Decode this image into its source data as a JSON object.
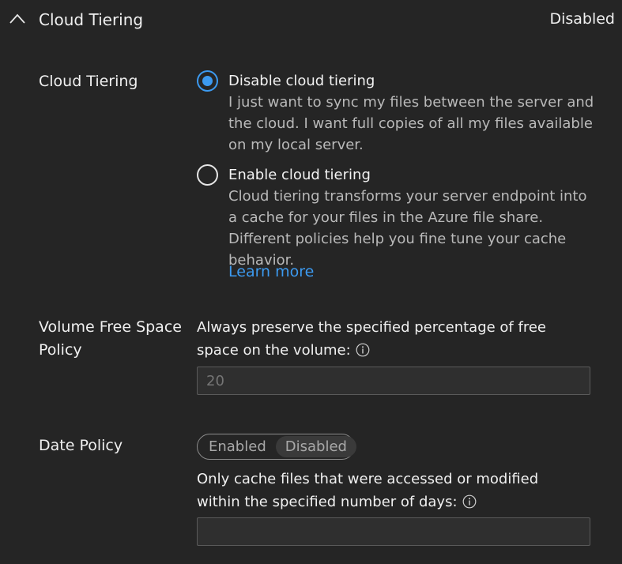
{
  "header": {
    "title": "Cloud Tiering",
    "status": "Disabled"
  },
  "cloud_tiering": {
    "label": "Cloud Tiering",
    "options": [
      {
        "title": "Disable cloud tiering",
        "description": "I just want to sync my files between the server and the cloud. I want full copies of all my files available on my local server.",
        "checked": true
      },
      {
        "title": "Enable cloud tiering",
        "description": "Cloud tiering transforms your server endpoint into a cache for your files in the Azure file share. Different policies help you fine tune your cache behavior.",
        "checked": false
      }
    ],
    "learn_more": "Learn more"
  },
  "volume_policy": {
    "label_line1": "Volume Free Space",
    "label_line2": "Policy",
    "description": "Always preserve the specified percentage of free space on the volume:",
    "placeholder": "20"
  },
  "date_policy": {
    "label": "Date Policy",
    "toggle": {
      "options": [
        "Enabled",
        "Disabled"
      ],
      "selected": "Disabled"
    },
    "description": "Only cache files that were accessed or modified within the specified number of days:",
    "value": ""
  },
  "colors": {
    "background": "#252525",
    "accent": "#3c9af0",
    "text": "#f0f0f0",
    "muted_text": "#b9b9b9"
  },
  "icons": {
    "collapse": "chevron-up-icon",
    "info": "info-icon"
  }
}
